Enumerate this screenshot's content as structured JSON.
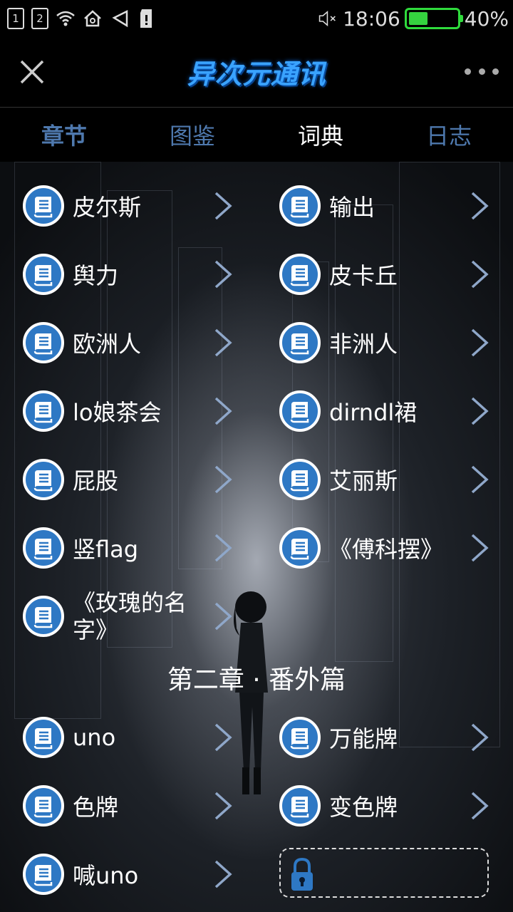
{
  "status_bar": {
    "sim1": "1",
    "sim2": "2",
    "time": "18:06",
    "battery_percent": "40%",
    "battery_level": 0.4,
    "icons": [
      "wifi-icon",
      "home-icon",
      "nfc-icon",
      "sd-card-icon",
      "mute-icon"
    ]
  },
  "header": {
    "logo_text": "异次元通讯",
    "close_icon": "close-icon",
    "more_icon": "more-icon"
  },
  "tabs": [
    {
      "label": "章节"
    },
    {
      "label": "图鉴"
    },
    {
      "label": "词典"
    },
    {
      "label": "日志"
    }
  ],
  "active_tab": "词典",
  "entries": [
    {
      "label": "皮尔斯"
    },
    {
      "label": "输出"
    },
    {
      "label": "舆力"
    },
    {
      "label": "皮卡丘"
    },
    {
      "label": "欧洲人"
    },
    {
      "label": "非洲人"
    },
    {
      "label": "lo娘茶会"
    },
    {
      "label": "dirndl裙"
    },
    {
      "label": "屁股"
    },
    {
      "label": "艾丽斯"
    },
    {
      "label": "竖flag"
    },
    {
      "label": "《傅科摆》"
    },
    {
      "label": "《玫瑰的名字》"
    }
  ],
  "section2": {
    "title": "第二章 · 番外篇",
    "entries": [
      {
        "label": "uno"
      },
      {
        "label": "万能牌"
      },
      {
        "label": "色牌"
      },
      {
        "label": "变色牌"
      },
      {
        "label": "喊uno"
      }
    ]
  },
  "colors": {
    "accent_blue": "#2e78c4",
    "tab_inactive": "#4e78ad",
    "battery_green": "#35d23f"
  }
}
